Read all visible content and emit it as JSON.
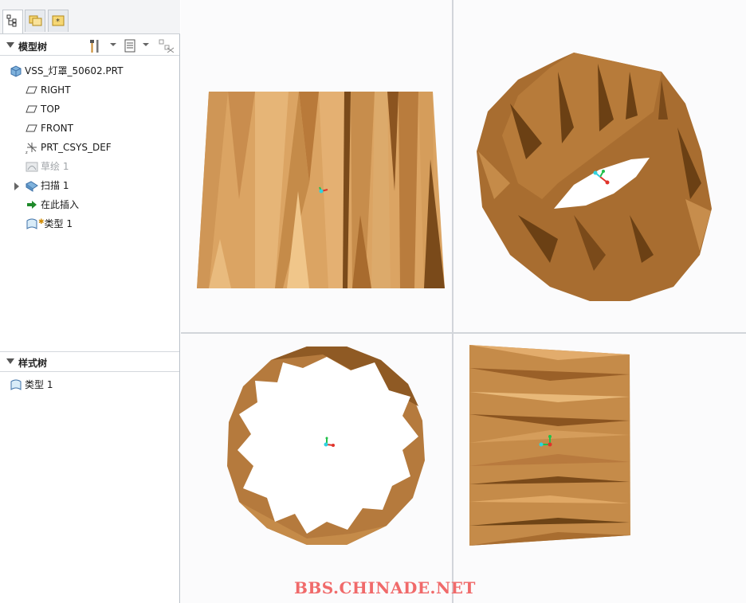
{
  "tabs": [
    {
      "name": "model-tree-tab-icon"
    },
    {
      "name": "folder-browser-tab-icon"
    },
    {
      "name": "favorites-tab-icon"
    }
  ],
  "model_tree": {
    "title": "模型树",
    "items": [
      {
        "label": "VSS_灯罩_50602.PRT",
        "icon": "part-icon"
      },
      {
        "label": "RIGHT",
        "icon": "datum-plane-icon"
      },
      {
        "label": "TOP",
        "icon": "datum-plane-icon"
      },
      {
        "label": "FRONT",
        "icon": "datum-plane-icon"
      },
      {
        "label": "PRT_CSYS_DEF",
        "icon": "csys-icon"
      },
      {
        "label": "草绘 1",
        "icon": "sketch-icon"
      },
      {
        "label": "扫描 1",
        "icon": "sweep-icon"
      },
      {
        "label": "在此插入",
        "icon": "insert-here-arrow-icon"
      },
      {
        "label": "类型 1",
        "icon": "style-icon"
      }
    ]
  },
  "style_tree": {
    "title": "样式树",
    "items": [
      {
        "label": "类型 1",
        "icon": "style-icon"
      }
    ]
  },
  "viewport": {
    "views": [
      "front-view",
      "isometric-view",
      "top-view",
      "side-view"
    ]
  },
  "colors": {
    "model_light": "#e0a865",
    "model_mid": "#b87a3e",
    "model_dark": "#6e4416",
    "axis_x": "#e0332a",
    "axis_y": "#22c04a",
    "axis_z": "#2fd2e0"
  },
  "watermark": "BBS.CHINADE.NET"
}
